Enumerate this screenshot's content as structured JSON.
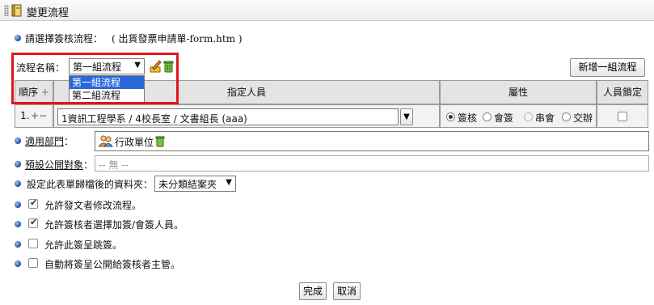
{
  "window": {
    "title": "變更流程"
  },
  "choose_flow": {
    "label": "請選擇簽核流程：",
    "form_info": "( 出貨發票申請單-form.htm )"
  },
  "flow_name": {
    "label": "流程名稱：",
    "selected": "第一組流程",
    "options": [
      "第一組流程",
      "第二組流程"
    ],
    "add_button": "新增一組流程"
  },
  "table": {
    "headers": {
      "order": "順序",
      "plus": "+",
      "assignee": "指定人員",
      "property": "屬性",
      "lock": "人員鎖定"
    },
    "row": {
      "index": "1.",
      "plus": "+",
      "minus": "−",
      "assignee": "1資訊工程學系 / 4校長室 / 文書組長 (aaa)",
      "property_options": [
        "簽核",
        "會簽",
        "串會",
        "交辦"
      ],
      "property_selected": "簽核",
      "locked": false
    }
  },
  "dept": {
    "label": "適用部門",
    "suffix": "：",
    "value": "行政單位"
  },
  "public": {
    "label": "預設公開對象",
    "suffix": "：",
    "value": "-- 無 --"
  },
  "archive": {
    "label": "設定此表單歸檔後的資料夾：",
    "selected": "未分類結案夾"
  },
  "options": [
    {
      "label": "允許發文者修改流程。",
      "checked": true
    },
    {
      "label": "允許簽核者選擇加簽/會簽人員。",
      "checked": true
    },
    {
      "label": "允許此簽呈跳簽。",
      "checked": false
    },
    {
      "label": "自動將簽呈公開給簽核者主管。",
      "checked": false
    }
  ],
  "footer": {
    "ok": "完成",
    "cancel": "取消"
  },
  "colors": {
    "highlight_border": "#e0161d",
    "selected_option_bg": "#2a68d8",
    "bullet": "#1d4e9a"
  }
}
